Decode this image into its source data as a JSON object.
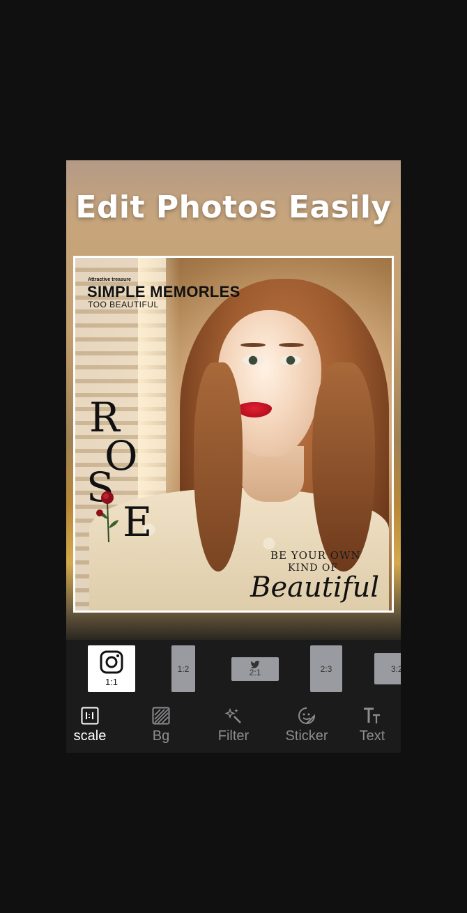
{
  "header": {
    "headline": "Edit Photos Easily"
  },
  "photo": {
    "overlay_small": "Attractive treasure",
    "overlay_title": "SIMPLE MEMORLES",
    "overlay_subtitle": "TOO BEAUTIFUL",
    "rose_letters": [
      "R",
      "O",
      "S",
      "E"
    ],
    "quote_line1": "BE YOUR OWN",
    "quote_line2": "KIND OF",
    "quote_script": "Beautiful"
  },
  "ratios": [
    {
      "label": "1:1",
      "icon": "instagram-icon",
      "selected": true
    },
    {
      "label": "1:2",
      "selected": false
    },
    {
      "label": "2:1",
      "icon": "twitter-icon",
      "selected": false
    },
    {
      "label": "2:3",
      "selected": false
    },
    {
      "label": "3:2",
      "selected": false
    }
  ],
  "tabs": [
    {
      "label": "scale",
      "icon": "scale-icon",
      "active": true
    },
    {
      "label": "Bg",
      "icon": "background-icon",
      "active": false
    },
    {
      "label": "Filter",
      "icon": "filter-sparkle-icon",
      "active": false
    },
    {
      "label": "Sticker",
      "icon": "sticker-icon",
      "active": false
    },
    {
      "label": "Text",
      "icon": "text-icon",
      "active": false
    }
  ],
  "colors": {
    "app_background": "#101010",
    "toolbar_background": "#1b1b1b",
    "ratio_inactive": "#9a9ba0",
    "ratio_selected": "#ffffff",
    "tab_inactive": "#8d8d92",
    "tab_active": "#ffffff",
    "lip_red": "#d01424"
  }
}
